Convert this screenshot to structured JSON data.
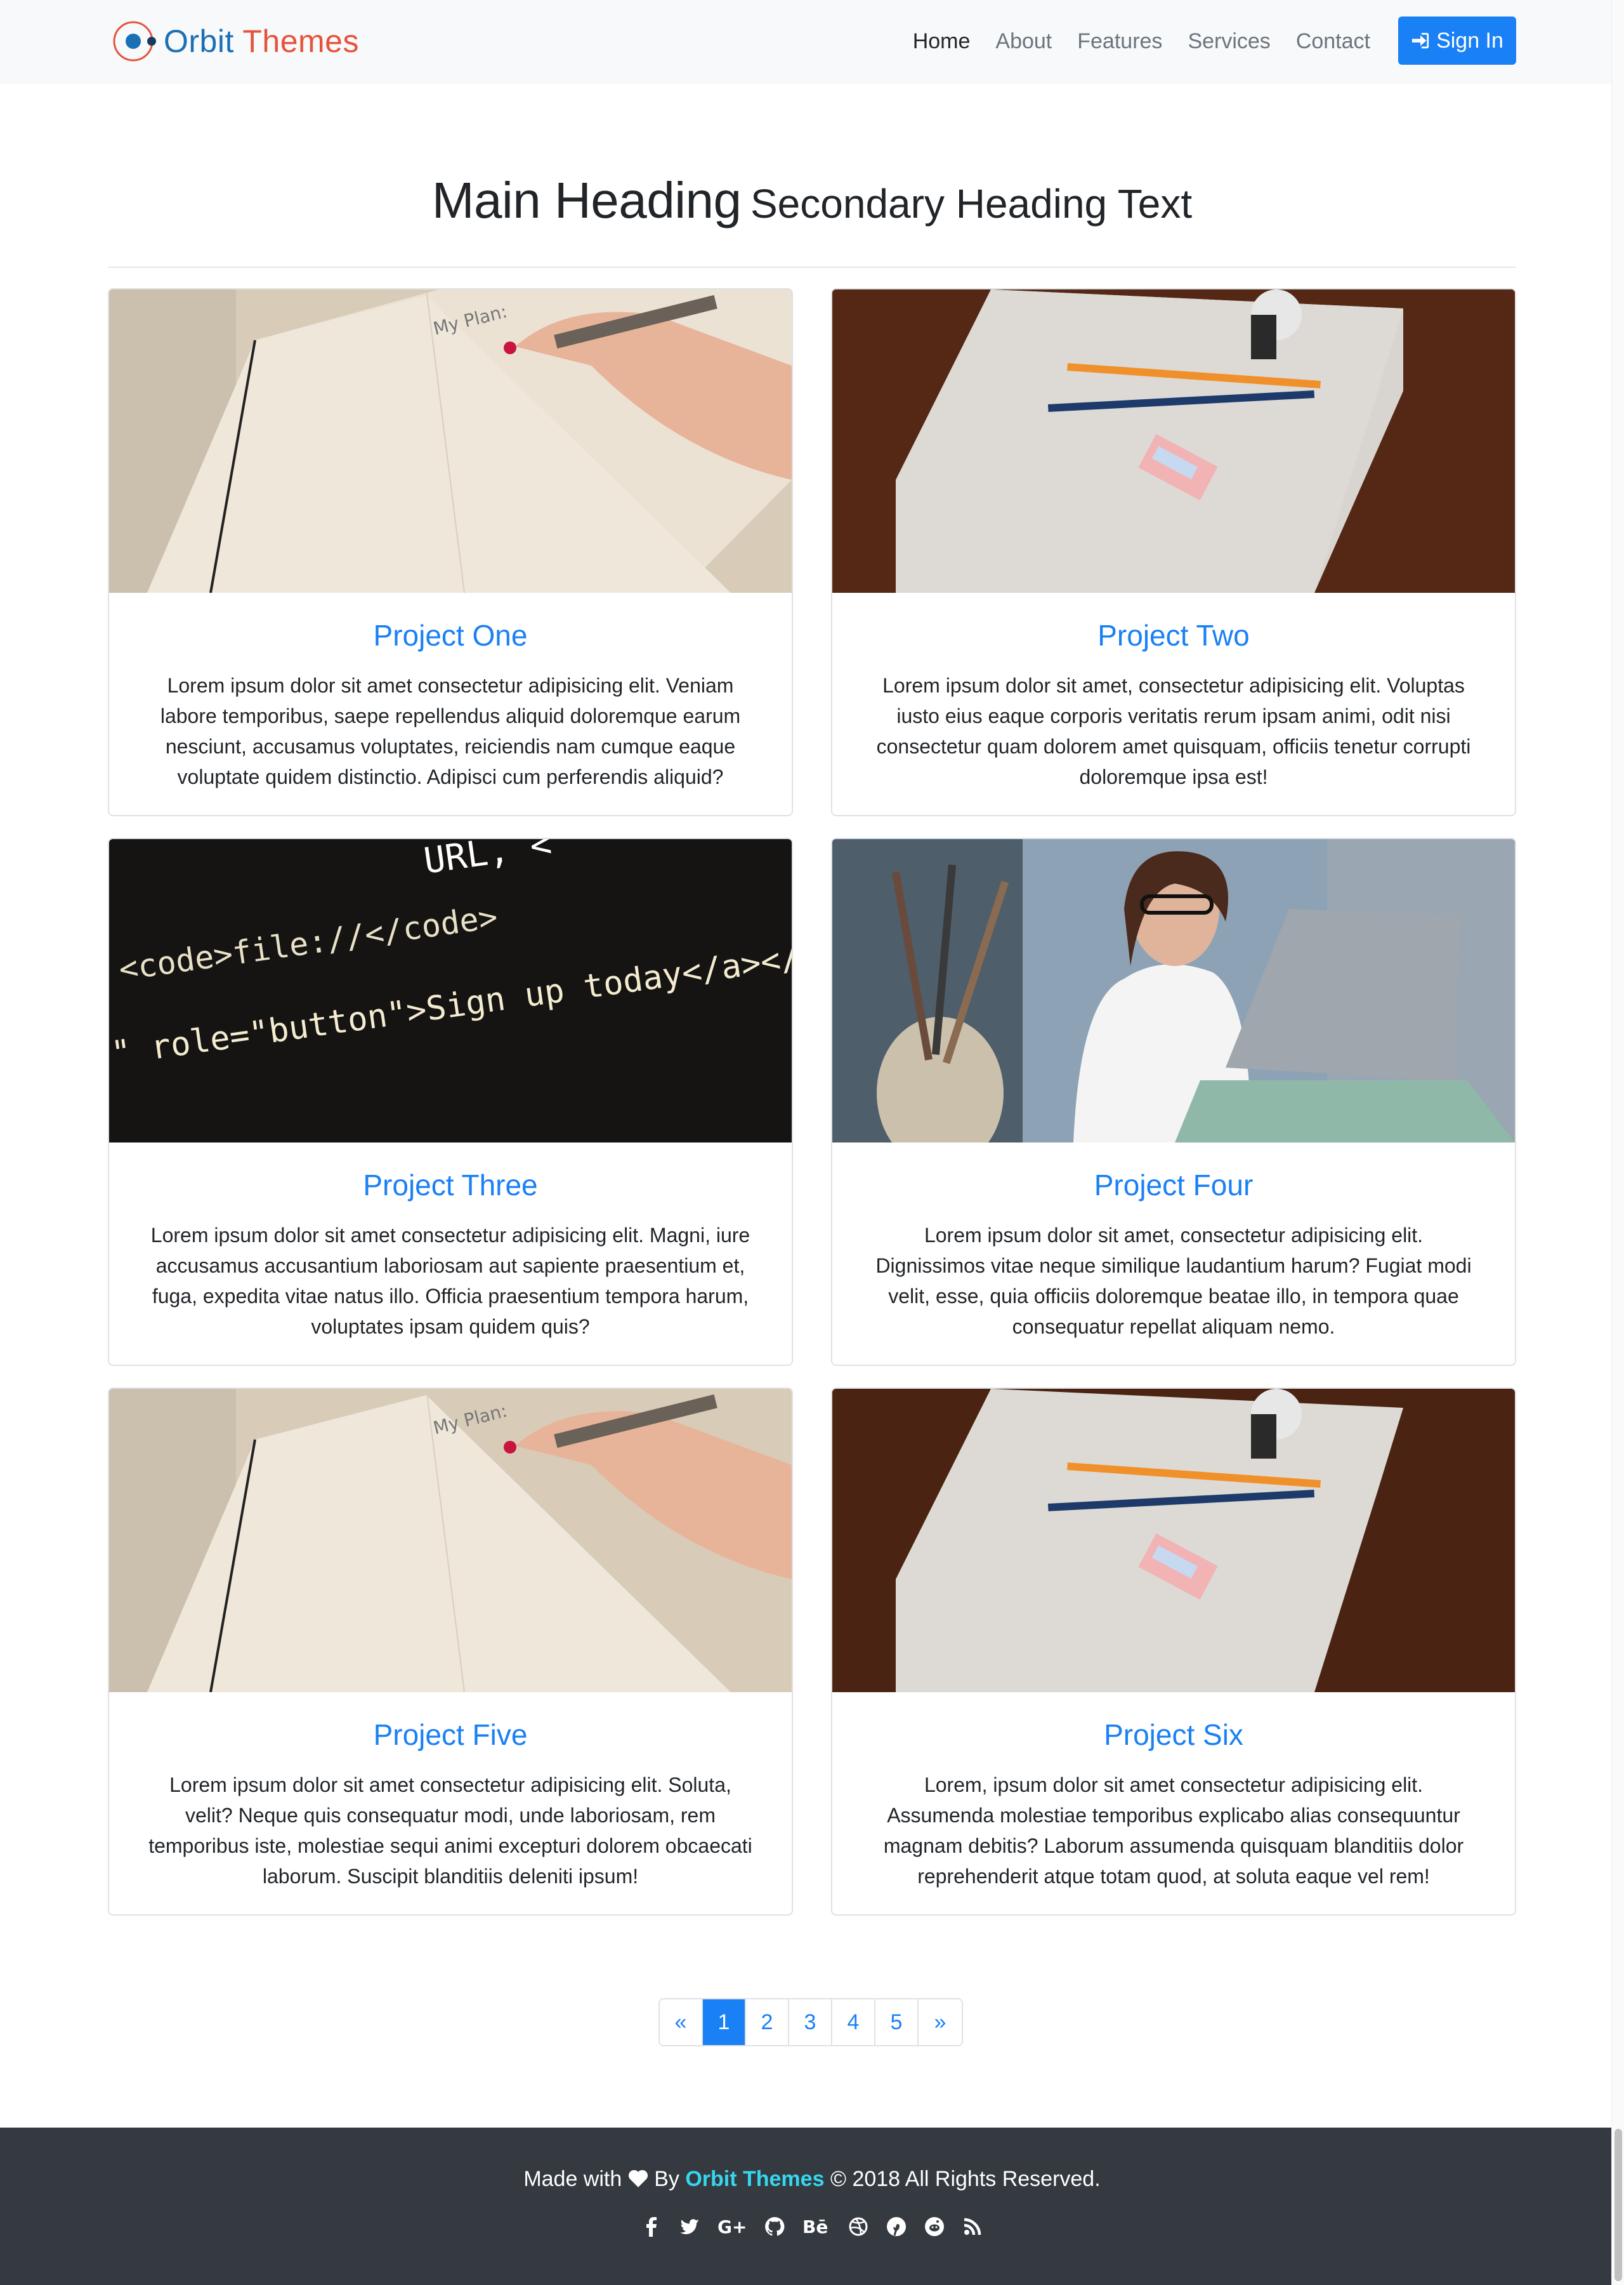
{
  "navbar": {
    "brand_part1": "Orbit",
    "brand_part2": "Themes",
    "links": [
      "Home",
      "About",
      "Features",
      "Services",
      "Contact"
    ],
    "active_link": "Home",
    "signin_label": "Sign In",
    "signin_icon": "sign-in-icon"
  },
  "header": {
    "main_heading": "Main Heading",
    "secondary_heading": "Secondary Heading Text"
  },
  "projects": [
    {
      "title": "Project One",
      "image": "notebook-writing-photo",
      "text": "Lorem ipsum dolor sit amet consectetur adipisicing elit. Veniam labore temporibus, saepe repellendus aliquid doloremque earum nesciunt, accusamus voluptates, reiciendis nam cumque eaque voluptate quidem distinctio. Adipisci cum perferendis aliquid?"
    },
    {
      "title": "Project Two",
      "image": "pencils-on-paper-photo",
      "text": "Lorem ipsum dolor sit amet, consectetur adipisicing elit. Voluptas iusto eius eaque corporis veritatis rerum ipsam animi, odit nisi consectetur quam dolorem amet quisquam, officiis tenetur corrupti doloremque ipsa est!"
    },
    {
      "title": "Project Three",
      "image": "code-screen-photo",
      "text": "Lorem ipsum dolor sit amet consectetur adipisicing elit. Magni, iure accusamus accusantium laboriosam aut sapiente praesentium et, fuga, expedita vitae natus illo. Officia praesentium tempora harum, voluptates ipsam quidem quis?"
    },
    {
      "title": "Project Four",
      "image": "woman-at-laptop-photo",
      "text": "Lorem ipsum dolor sit amet, consectetur adipisicing elit. Dignissimos vitae neque similique laudantium harum? Fugiat modi velit, esse, quia officiis doloremque beatae illo, in tempora quae consequatur repellat aliquam nemo."
    },
    {
      "title": "Project Five",
      "image": "notebook-writing-photo",
      "text": "Lorem ipsum dolor sit amet consectetur adipisicing elit. Soluta, velit? Neque quis consequatur modi, unde laboriosam, rem temporibus iste, molestiae sequi animi excepturi dolorem obcaecati laborum. Suscipit blanditiis deleniti ipsum!"
    },
    {
      "title": "Project Six",
      "image": "pencils-on-paper-photo",
      "text": "Lorem, ipsum dolor sit amet consectetur adipisicing elit. Assumenda molestiae temporibus explicabo alias consequuntur magnam debitis? Laborum assumenda quisquam blanditiis dolor reprehenderit atque totam quod, at soluta eaque vel rem!"
    }
  ],
  "code_image_text": {
    "line1": "URL, <",
    "line2": "<code>file://</code>",
    "line3": "\" role=\"button\">Sign up today</a></p>"
  },
  "pagination": {
    "prev": "«",
    "pages": [
      "1",
      "2",
      "3",
      "4",
      "5"
    ],
    "next": "»",
    "current": "1"
  },
  "footer": {
    "made_with": "Made with",
    "by": "By",
    "brand": "Orbit Themes",
    "copyright": "© 2018 All Rights Reserved.",
    "social": [
      "facebook-icon",
      "twitter-icon",
      "google-plus-icon",
      "github-icon",
      "behance-icon",
      "dribbble-icon",
      "pinterest-icon",
      "reddit-icon",
      "rss-icon"
    ]
  },
  "colors": {
    "primary": "#1a80f5",
    "navbar_bg": "#f8f9fa",
    "footer_bg": "#343a40",
    "footer_brand": "#36d6f0",
    "logo_blue": "#1a6fb5",
    "logo_red": "#e5533d"
  }
}
